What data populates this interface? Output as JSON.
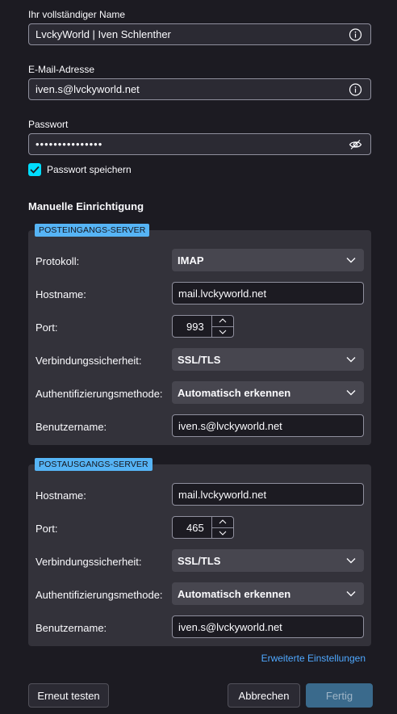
{
  "account": {
    "name_label": "Ihr vollständiger Name",
    "name_value": "LvckyWorld | Iven Schlenther",
    "email_label": "E-Mail-Adresse",
    "email_value": "iven.s@lvckyworld.net",
    "password_label": "Passwort",
    "password_value": "•••••••••••••••",
    "remember_label": "Passwort speichern",
    "remember_checked": true
  },
  "manual": {
    "title": "Manuelle Einrichtigung",
    "incoming": {
      "badge": "POSTEINGANGS-SERVER",
      "protocol_label": "Protokoll:",
      "protocol_value": "IMAP",
      "hostname_label": "Hostname:",
      "hostname_value": "mail.lvckyworld.net",
      "port_label": "Port:",
      "port_value": "993",
      "security_label": "Verbindungssicherheit:",
      "security_value": "SSL/TLS",
      "auth_label": "Authentifizierungsmethode:",
      "auth_value": "Automatisch erkennen",
      "username_label": "Benutzername:",
      "username_value": "iven.s@lvckyworld.net"
    },
    "outgoing": {
      "badge": "POSTAUSGANGS-SERVER",
      "hostname_label": "Hostname:",
      "hostname_value": "mail.lvckyworld.net",
      "port_label": "Port:",
      "port_value": "465",
      "security_label": "Verbindungssicherheit:",
      "security_value": "SSL/TLS",
      "auth_label": "Authentifizierungsmethode:",
      "auth_value": "Automatisch erkennen",
      "username_label": "Benutzername:",
      "username_value": "iven.s@lvckyworld.net"
    },
    "advanced_link": "Erweiterte Einstellungen"
  },
  "buttons": {
    "retest": "Erneut testen",
    "cancel": "Abbrechen",
    "done": "Fertig"
  },
  "colors": {
    "background": "#1c1b22",
    "accent": "#00ddff",
    "badge": "#56b4f5",
    "link": "#4fa8ff"
  }
}
